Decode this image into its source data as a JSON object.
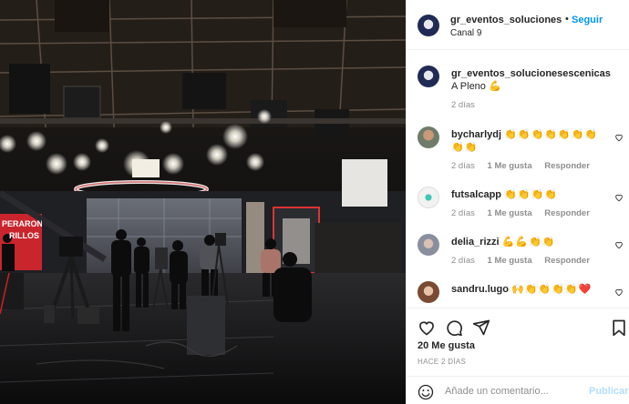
{
  "post": {
    "username": "gr_eventos_solucionesescenicas",
    "follow_label": "Seguir",
    "follow_dot": "•",
    "location": "Canal 9"
  },
  "caption": {
    "username": "gr_eventos_solucionesescenicas",
    "text": "A Pleno",
    "emoji": "💪",
    "time": "2 días"
  },
  "comments": [
    {
      "username": "bycharlydj",
      "text": "👏👏👏👏👏👏👏👏👏",
      "time": "2 días",
      "likes": "1 Me gusta",
      "reply": "Responder"
    },
    {
      "username": "futsalcapp",
      "text": "👏👏👏👏",
      "time": "2 días",
      "likes": "1 Me gusta",
      "reply": "Responder"
    },
    {
      "username": "delia_rizzi",
      "text": "💪💪👏👏",
      "time": "2 días",
      "likes": "1 Me gusta",
      "reply": "Responder"
    },
    {
      "username": "sandru.lugo",
      "text": "🙌👏👏👏👏❤️",
      "time": "",
      "likes": "",
      "reply": ""
    }
  ],
  "likes_count": "20 Me gusta",
  "post_date": "HACE 2 DÍAS",
  "comment_box": {
    "placeholder": "Añade un comentario...",
    "publish_label": "Publicar"
  },
  "photo_overlay": {
    "screen_text_line1": "PERARON",
    "screen_text_line2": "RILLOS"
  },
  "colors": {
    "accent": "#0095f6",
    "publish_disabled": "#b2dffc",
    "muted": "#8e8e8e",
    "text": "#262626"
  },
  "icons": [
    "like-icon",
    "comment-icon",
    "share-icon",
    "save-icon",
    "emoji-icon",
    "comment-heart-icon"
  ]
}
